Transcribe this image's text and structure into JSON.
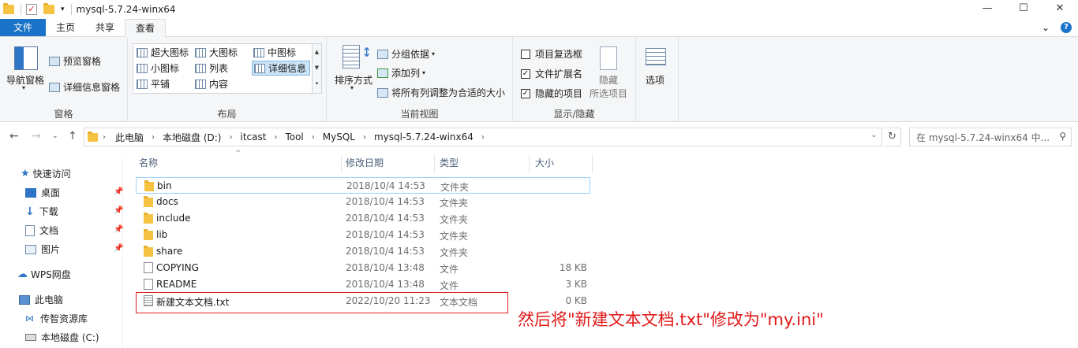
{
  "window": {
    "title": "mysql-5.7.24-winx64",
    "controls": [
      "—",
      "☐",
      "✕"
    ]
  },
  "tabs": {
    "file": "文件",
    "home": "主页",
    "share": "共享",
    "view": "查看",
    "expand": "⌄",
    "help": "?"
  },
  "ribbon": {
    "pane": {
      "nav": "导航窗格",
      "preview": "预览窗格",
      "details": "详细信息窗格",
      "label": "窗格"
    },
    "layout": {
      "label": "布局",
      "items": [
        "超大图标",
        "大图标",
        "中图标",
        "小图标",
        "列表",
        "详细信息",
        "平铺",
        "内容"
      ],
      "selected": "详细信息"
    },
    "current_view": {
      "sort": "排序方式",
      "group_by": "分组依据",
      "add_columns": "添加列",
      "fit_columns": "将所有列调整为合适的大小",
      "label": "当前视图"
    },
    "show_hide": {
      "item_checkboxes": "项目复选框",
      "file_extensions": "文件扩展名",
      "hidden_items": "隐藏的项目",
      "hide_selected_1": "隐藏",
      "hide_selected_2": "所选项目",
      "options": "选项",
      "label": "显示/隐藏",
      "checked": {
        "item_checkboxes": false,
        "file_extensions": true,
        "hidden_items": true
      }
    }
  },
  "address": {
    "crumbs": [
      "此电脑",
      "本地磁盘 (D:)",
      "itcast",
      "Tool",
      "MySQL",
      "mysql-5.7.24-winx64"
    ],
    "search_placeholder": "在 mysql-5.7.24-winx64 中..."
  },
  "nav": {
    "quick_access": "快速访问",
    "desktop": "桌面",
    "downloads": "下载",
    "documents": "文档",
    "pictures": "图片",
    "wps": "WPS网盘",
    "this_pc": "此电脑",
    "chuanzhi": "传智资源库",
    "local_c": "本地磁盘 (C:)"
  },
  "columns": {
    "name": "名称",
    "date": "修改日期",
    "type": "类型",
    "size": "大小"
  },
  "files": [
    {
      "name": "bin",
      "date": "2018/10/4 14:53",
      "type": "文件夹",
      "size": "",
      "kind": "folder"
    },
    {
      "name": "docs",
      "date": "2018/10/4 14:53",
      "type": "文件夹",
      "size": "",
      "kind": "folder"
    },
    {
      "name": "include",
      "date": "2018/10/4 14:53",
      "type": "文件夹",
      "size": "",
      "kind": "folder"
    },
    {
      "name": "lib",
      "date": "2018/10/4 14:53",
      "type": "文件夹",
      "size": "",
      "kind": "folder"
    },
    {
      "name": "share",
      "date": "2018/10/4 14:53",
      "type": "文件夹",
      "size": "",
      "kind": "folder"
    },
    {
      "name": "COPYING",
      "date": "2018/10/4 13:48",
      "type": "文件",
      "size": "18 KB",
      "kind": "doc"
    },
    {
      "name": "README",
      "date": "2018/10/4 13:48",
      "type": "文件",
      "size": "3 KB",
      "kind": "doc"
    },
    {
      "name": "新建文本文档.txt",
      "date": "2022/10/20 11:23",
      "type": "文本文档",
      "size": "0 KB",
      "kind": "txt"
    }
  ],
  "annotation": "然后将\"新建文本文档.txt\"修改为\"my.ini\"",
  "colors": {
    "accent": "#1a73c8",
    "annotation": "#e01818",
    "selection": "#cce4f7"
  }
}
